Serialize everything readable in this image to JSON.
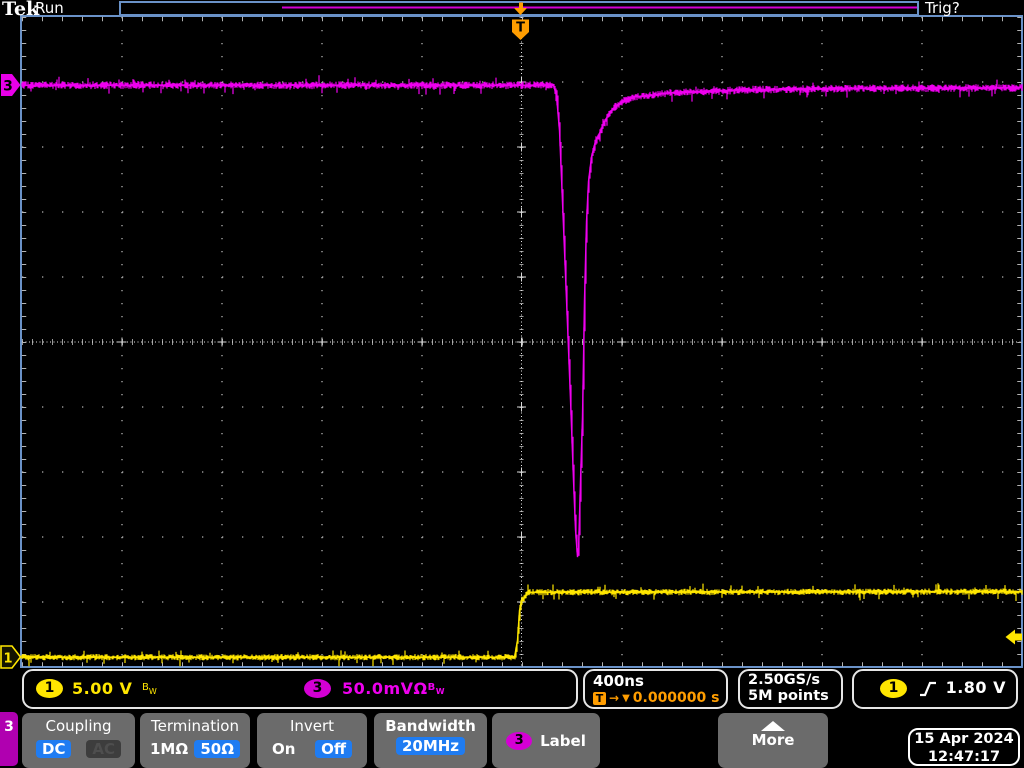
{
  "top_bar": {
    "logo": "Tek",
    "acquisition_status": "Run",
    "trigger_status": "Trig?",
    "trigger_flag": "T"
  },
  "markers": {
    "ch3": "3",
    "ch1": "1"
  },
  "status_bar": {
    "ch1": {
      "badge": "1",
      "scale": "5.00 V",
      "bw_b": "B",
      "bw_w": "W"
    },
    "ch3": {
      "badge": "3",
      "scale": "50.0mV",
      "ohm": "Ω",
      "bw_b": "B",
      "bw_w": "W"
    },
    "horizontal": {
      "scale": "400ns",
      "trig_label": "T",
      "arrow": "→",
      "marker": "▼",
      "position": "0.000000 s"
    },
    "acquisition": {
      "rate": "2.50GS/s",
      "record": "5M points"
    },
    "trigger": {
      "badge": "1",
      "level": "1.80 V"
    }
  },
  "menu": {
    "channel_tab": "3",
    "coupling": {
      "title": "Coupling",
      "dc": "DC",
      "ac": "AC"
    },
    "termination": {
      "title": "Termination",
      "opt1": "1MΩ",
      "opt2": "50Ω"
    },
    "invert": {
      "title": "Invert",
      "on": "On",
      "off": "Off"
    },
    "bandwidth": {
      "title": "Bandwidth",
      "value": "20MHz"
    },
    "label": {
      "badge": "3",
      "title": "Label"
    },
    "more": {
      "title": "More"
    },
    "datetime": {
      "date": "15 Apr 2024",
      "time": "12:47:17"
    }
  },
  "colors": {
    "ch1_trace": "#ffe600",
    "ch3_trace": "#ee00ee",
    "graticule_border": "#6a92c8",
    "trigger_orange": "#ff9d00",
    "selected_blue": "#1f7cf2",
    "channel3_badge": "#d400d4"
  },
  "chart_data": {
    "type": "line",
    "title": "Oscilloscope acquisition: CH3 negative spike at trigger, CH1 5V step",
    "timebase_ns_per_div": 400,
    "divisions": {
      "horizontal": 10,
      "vertical": 10
    },
    "sample_rate": "2.50GS/s",
    "record_length": "5M points",
    "trigger": {
      "source": "CH1",
      "level_V": 1.8,
      "slope": "rising",
      "position_s": "0.000000"
    },
    "series": [
      {
        "name": "CH3",
        "color": "#ee00ee",
        "units": "mV",
        "volts_per_div": 50,
        "vertical_offset_div": 3.95,
        "noise_div": 0.05,
        "points": [
          [
            -2000,
            0
          ],
          [
            128,
            0
          ],
          [
            140,
            -8
          ],
          [
            152,
            -35
          ],
          [
            164,
            -90
          ],
          [
            180,
            -165
          ],
          [
            196,
            -242
          ],
          [
            208,
            -304
          ],
          [
            216,
            -342
          ],
          [
            224,
            -363
          ],
          [
            228,
            -358
          ],
          [
            236,
            -304
          ],
          [
            244,
            -255
          ],
          [
            252,
            -165
          ],
          [
            260,
            -105
          ],
          [
            268,
            -74
          ],
          [
            280,
            -55
          ],
          [
            296,
            -43
          ],
          [
            312,
            -37
          ],
          [
            332,
            -28
          ],
          [
            352,
            -21
          ],
          [
            376,
            -16
          ],
          [
            408,
            -12
          ],
          [
            448,
            -9
          ],
          [
            504,
            -8
          ],
          [
            584,
            -6
          ],
          [
            712,
            -5
          ],
          [
            912,
            -3.5
          ],
          [
            1312,
            -2.5
          ],
          [
            2000,
            -2
          ]
        ]
      },
      {
        "name": "CH1",
        "color": "#ffe600",
        "units": "V",
        "volts_per_div": 5,
        "vertical_offset_div": -4.85,
        "noise_div": 0.04,
        "points": [
          [
            -2000,
            0
          ],
          [
            -28,
            0
          ],
          [
            -16,
            1.3
          ],
          [
            -8,
            3.6
          ],
          [
            0,
            4.4
          ],
          [
            12,
            4.6
          ],
          [
            24,
            5.0
          ],
          [
            2000,
            5.05
          ]
        ]
      }
    ]
  }
}
